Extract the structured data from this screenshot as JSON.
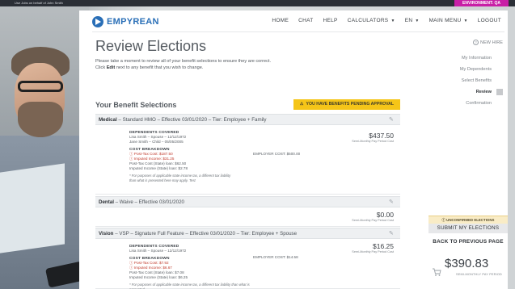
{
  "proxy_bar": {
    "text": "Use Jobs on behalf of John Smith"
  },
  "environment_badge": "ENVIRONMENT: QA",
  "brand": {
    "logo_text": "EMPYREAN",
    "accent": "#2a6fb7"
  },
  "nav": {
    "items": [
      {
        "label": "HOME",
        "has_caret": false
      },
      {
        "label": "CHAT",
        "has_caret": false
      },
      {
        "label": "HELP",
        "has_caret": false
      },
      {
        "label": "CALCULATORS",
        "has_caret": true
      },
      {
        "label": "EN",
        "has_caret": true
      },
      {
        "label": "MAIN MENU",
        "has_caret": true
      },
      {
        "label": "LOGOUT",
        "has_caret": false
      }
    ]
  },
  "page": {
    "title": "Review Elections",
    "intro_line1": "Please take a moment to review all of your benefit selections to ensure they are correct.",
    "intro_line2_prefix": "Click ",
    "intro_line2_bold": "Edit",
    "intro_line2_suffix": " next to any benefit that you wish to change."
  },
  "right_nav": {
    "new_hire": "NEW HIRE",
    "items": [
      {
        "label": "My Information",
        "active": false
      },
      {
        "label": "My Dependents",
        "active": false
      },
      {
        "label": "Select Benefits",
        "active": false
      },
      {
        "label": "Review",
        "active": true
      },
      {
        "label": "Confirmation",
        "active": false
      }
    ]
  },
  "selections": {
    "heading": "Your Benefit Selections",
    "pending_badge": "YOU HAVE BENEFITS PENDING APPROVAL",
    "pending_color": "#f5c518"
  },
  "benefits": {
    "medical": {
      "name": "Medical",
      "detail": " – Standard HMO – Effective 03/01/2020 – Tier: Employee + Family",
      "dependents_label": "DEPENDENTS COVERED",
      "dependents": [
        "Lisa Smith – Spouse – 12/12/1972",
        "Jane Smith – Child – 05/05/2005"
      ],
      "amount": "$437.50",
      "amount_sub": "Semi-Monthly Pay Period Cost",
      "cost_label": "COST BREAKDOWN",
      "employer_cost": "EMPLOYER COST: $500.00",
      "costs": [
        "Post-Tax Cost: $187.50",
        "Imputed Income: $31.25",
        "Post-Tax Cost (State) loan: $62.50",
        "Imputed Income (State) loan: $2.78"
      ],
      "note": "* For purposes of applicable state income tax, a different tax liability than what is presented here may apply. Test"
    },
    "dental": {
      "name": "Dental",
      "detail": " – Waive – Effective 03/01/2020",
      "amount": "$0.00",
      "amount_sub": "Semi-Monthly Pay Period Cost"
    },
    "vision": {
      "name": "Vision",
      "detail": " – VSP – Signature Full Feature – Effective 03/01/2020 – Tier: Employee + Spouse",
      "dependents_label": "DEPENDENTS COVERED",
      "dependents": [
        "Lisa Smith – Spouse – 12/12/1972"
      ],
      "amount": "$16.25",
      "amount_sub": "Semi-Monthly Pay Period Cost",
      "cost_label": "COST BREAKDOWN",
      "employer_cost": "EMPLOYER COST: $14.58",
      "costs": [
        "Post-Tax Cost: $7.92",
        "Imputed Income: $6.67",
        "Post-Tax Cost (State) loan: $7.08",
        "Imputed Income (State) loan: $6.25"
      ],
      "note": "* For purposes of applicable state income tax, a different tax liability than what is presented"
    }
  },
  "summary": {
    "uncovered": "UNCONFIRMED ELECTIONS",
    "submit": "SUBMIT MY ELECTIONS",
    "back": "BACK TO PREVIOUS PAGE",
    "total": "$390.83",
    "total_sub": "SEMI-MONTHLY PAY PERIOD"
  }
}
